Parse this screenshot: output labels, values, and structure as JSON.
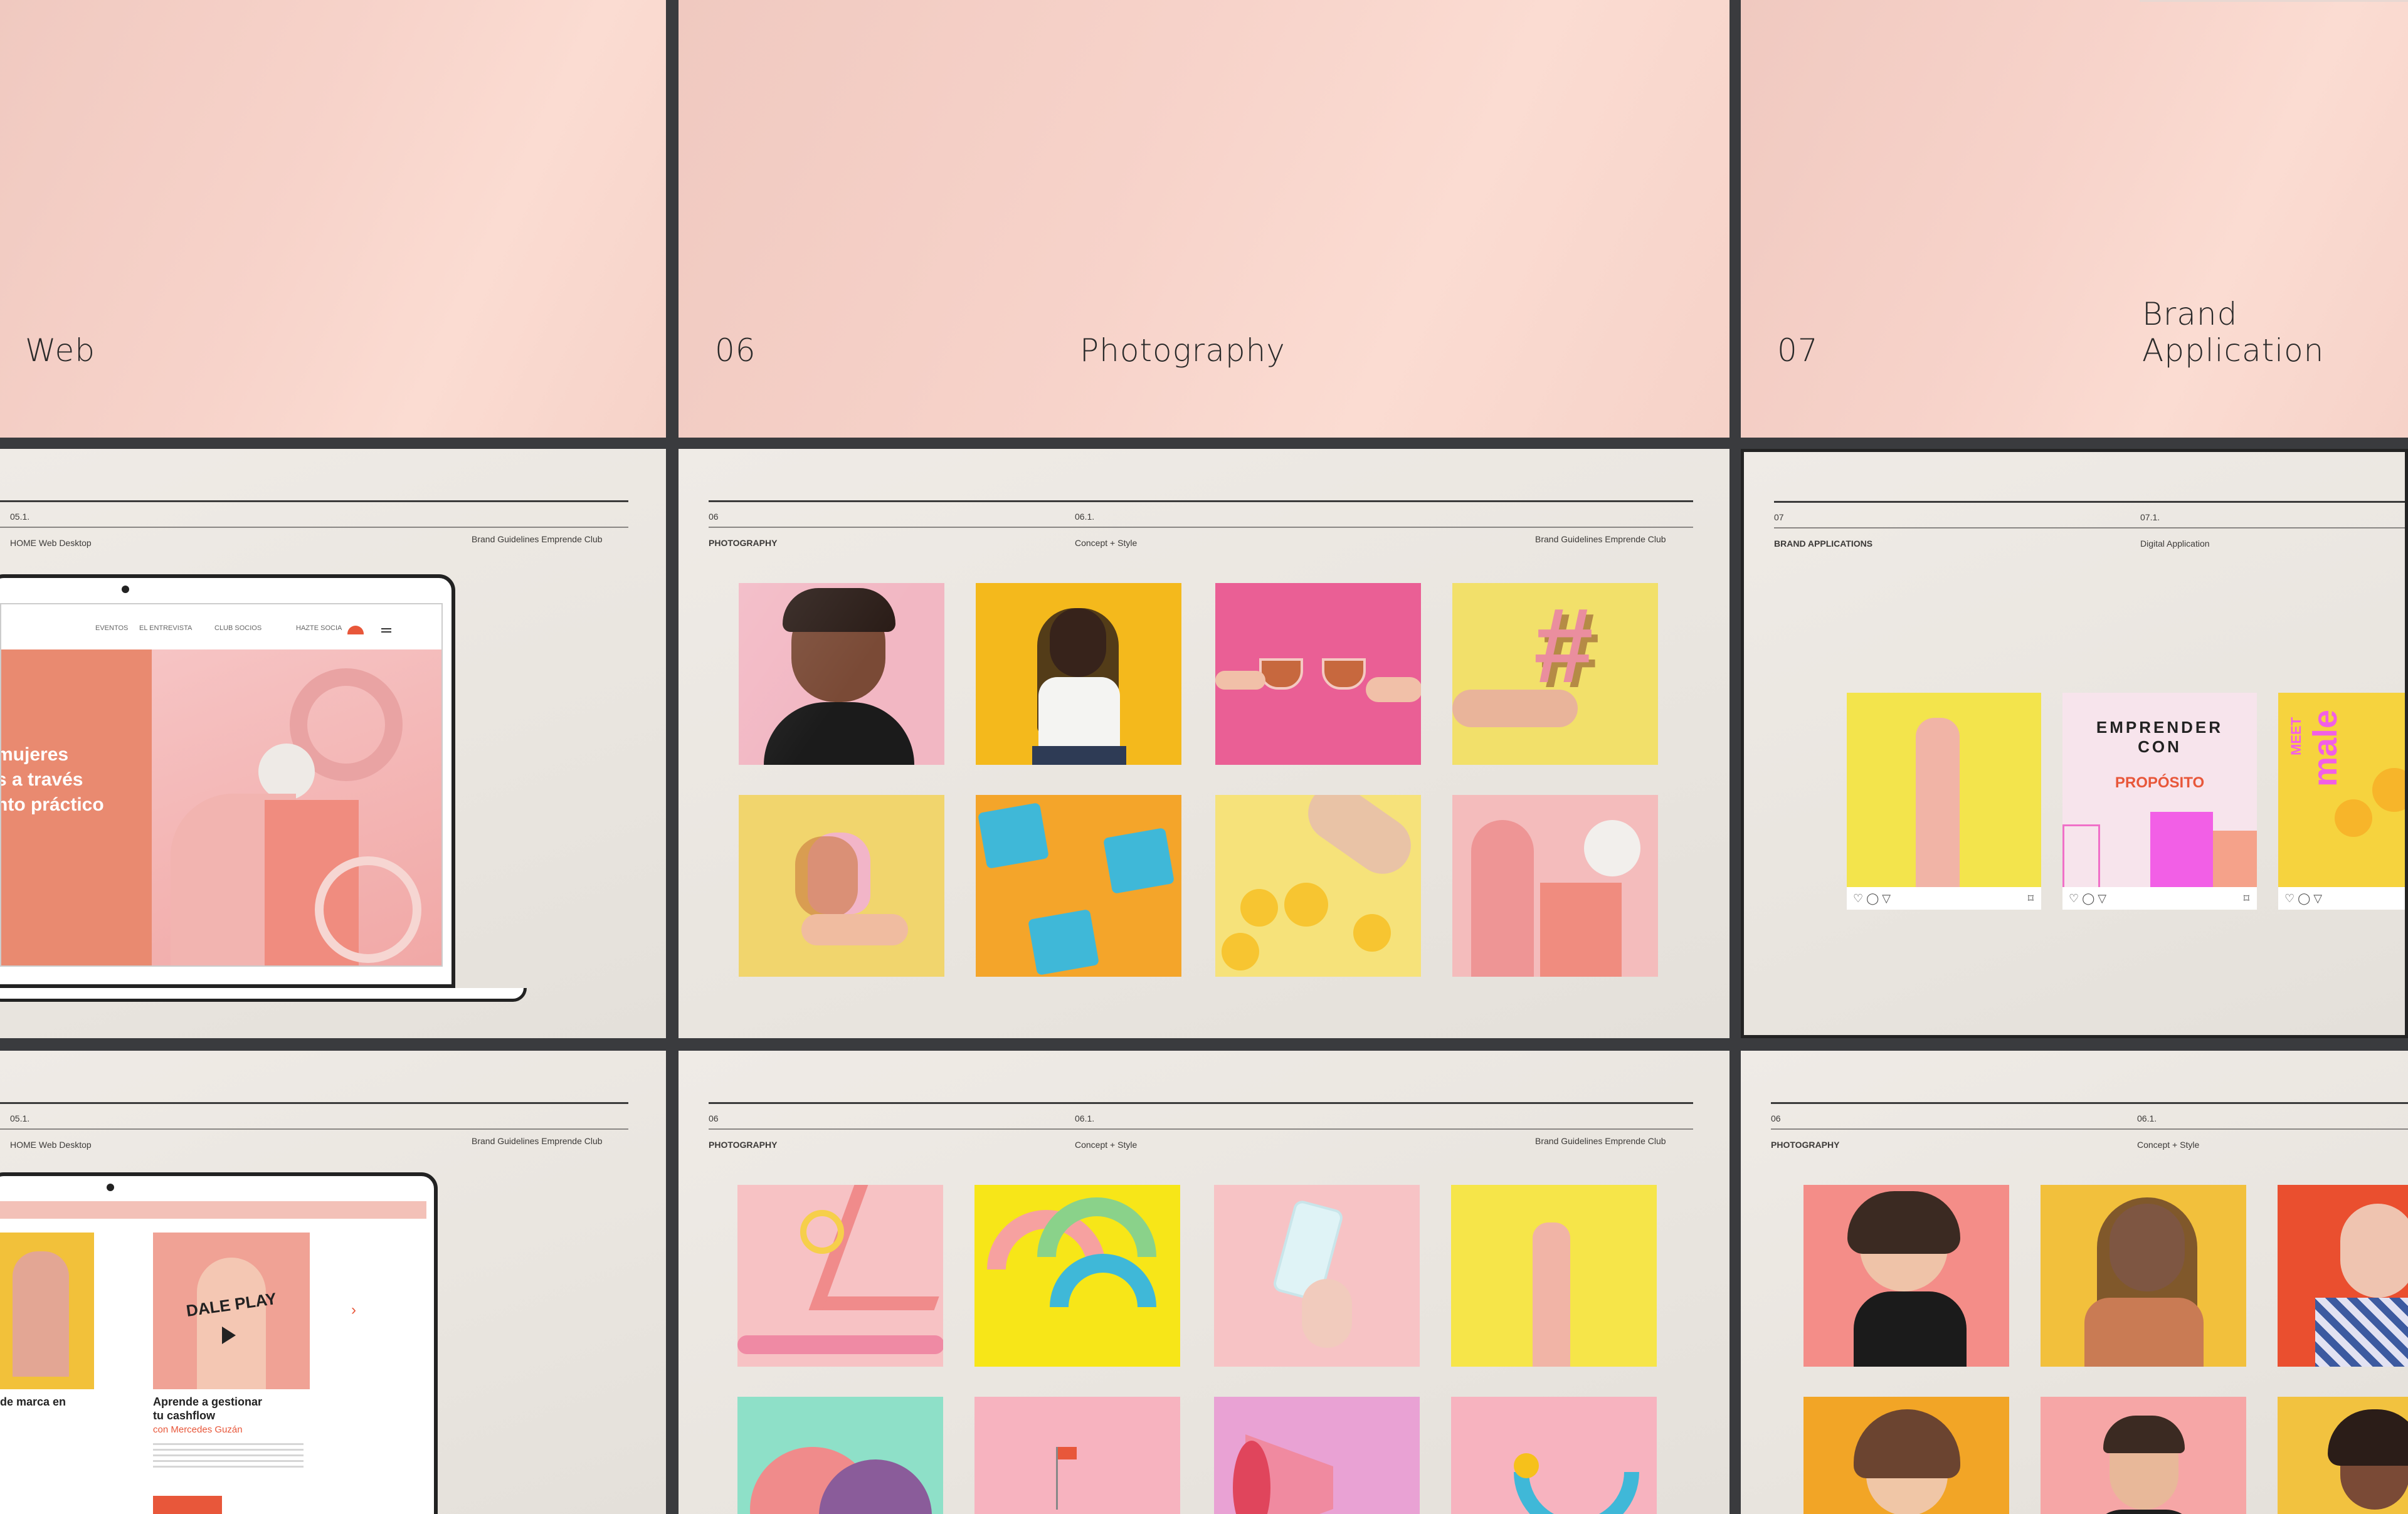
{
  "slides_top": {
    "left_title": "Web",
    "mid_number": "06",
    "mid_title": "Photography",
    "right_number": "07",
    "right_title": "Brand Application"
  },
  "slide_web_1": {
    "section_num": "05.1.",
    "section_label": "HOME Web Desktop",
    "brand_label": "Brand Guidelines Emprende Club",
    "hero_line1": "mujeres",
    "hero_line2": "s a través",
    "hero_line3": "nto práctico",
    "nav_items": [
      "EVENTOS",
      "EL ENTREVISTA",
      "CLUB SOCIOS",
      "HAZTE SOCIA"
    ]
  },
  "slide_photo_1": {
    "num": "06",
    "label": "PHOTOGRAPHY",
    "sub_num": "06.1.",
    "sub_label": "Concept + Style",
    "brand_label": "Brand Guidelines Emprende Club"
  },
  "slide_brand": {
    "num": "07",
    "label": "BRAND APPLICATIONS",
    "sub_num": "07.1.",
    "sub_label": "Digital Application",
    "post_text_arc": "EMPRENDER CON",
    "post_text_main": "PROPÓSITO",
    "post_meet": "MEET",
    "post_male": "male"
  },
  "slide_web_2": {
    "section_num": "05.1.",
    "section_label": "HOME Web Desktop",
    "brand_label": "Brand Guidelines Emprende Club",
    "card1_title": "de marca en",
    "card2_title_line1": "Aprende a gestionar",
    "card2_title_line2": "tu cashflow",
    "card2_author": "con Mercedes Guzán",
    "play_text": "DALE PLAY"
  },
  "slide_photo_2": {
    "num": "06",
    "label": "PHOTOGRAPHY",
    "sub_num": "06.1.",
    "sub_label": "Concept + Style",
    "brand_label": "Brand Guidelines Emprende Club"
  },
  "slide_photo_3": {
    "num": "06",
    "label": "PHOTOGRAPHY",
    "sub_num": "06.1.",
    "sub_label": "Concept + Style"
  },
  "colors": {
    "accent_orange": "#e8573a",
    "pink": "#f7d3ca",
    "yellow": "#f4e04a",
    "blue": "#3fb8d8"
  }
}
